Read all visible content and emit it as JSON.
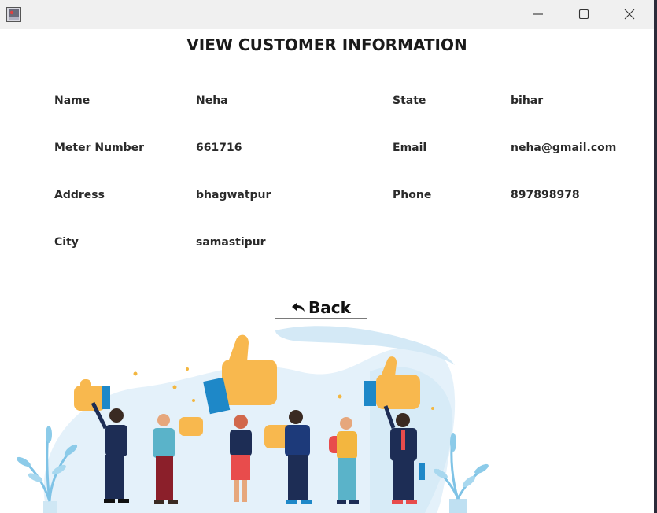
{
  "window": {
    "controls": {
      "minimize": "minimize-icon",
      "maximize": "maximize-icon",
      "close": "close-icon"
    }
  },
  "heading": "VIEW CUSTOMER INFORMATION",
  "fields": {
    "name_label": "Name",
    "name_value": "Neha",
    "meter_label": "Meter Number",
    "meter_value": "661716",
    "address_label": "Address",
    "address_value": "bhagwatpur",
    "city_label": "City",
    "city_value": "samastipur",
    "state_label": "State",
    "state_value": "bihar",
    "email_label": "Email",
    "email_value": "neha@gmail.com",
    "phone_label": "Phone",
    "phone_value": "897898978"
  },
  "back_button": {
    "label": "Back",
    "icon": "back-arrow-icon"
  },
  "colors": {
    "thumb": "#f8b84e",
    "cuff": "#1e88c8",
    "blob": "#e3f1fa",
    "plant": "#7fc3e6",
    "navy": "#1d2d55"
  }
}
